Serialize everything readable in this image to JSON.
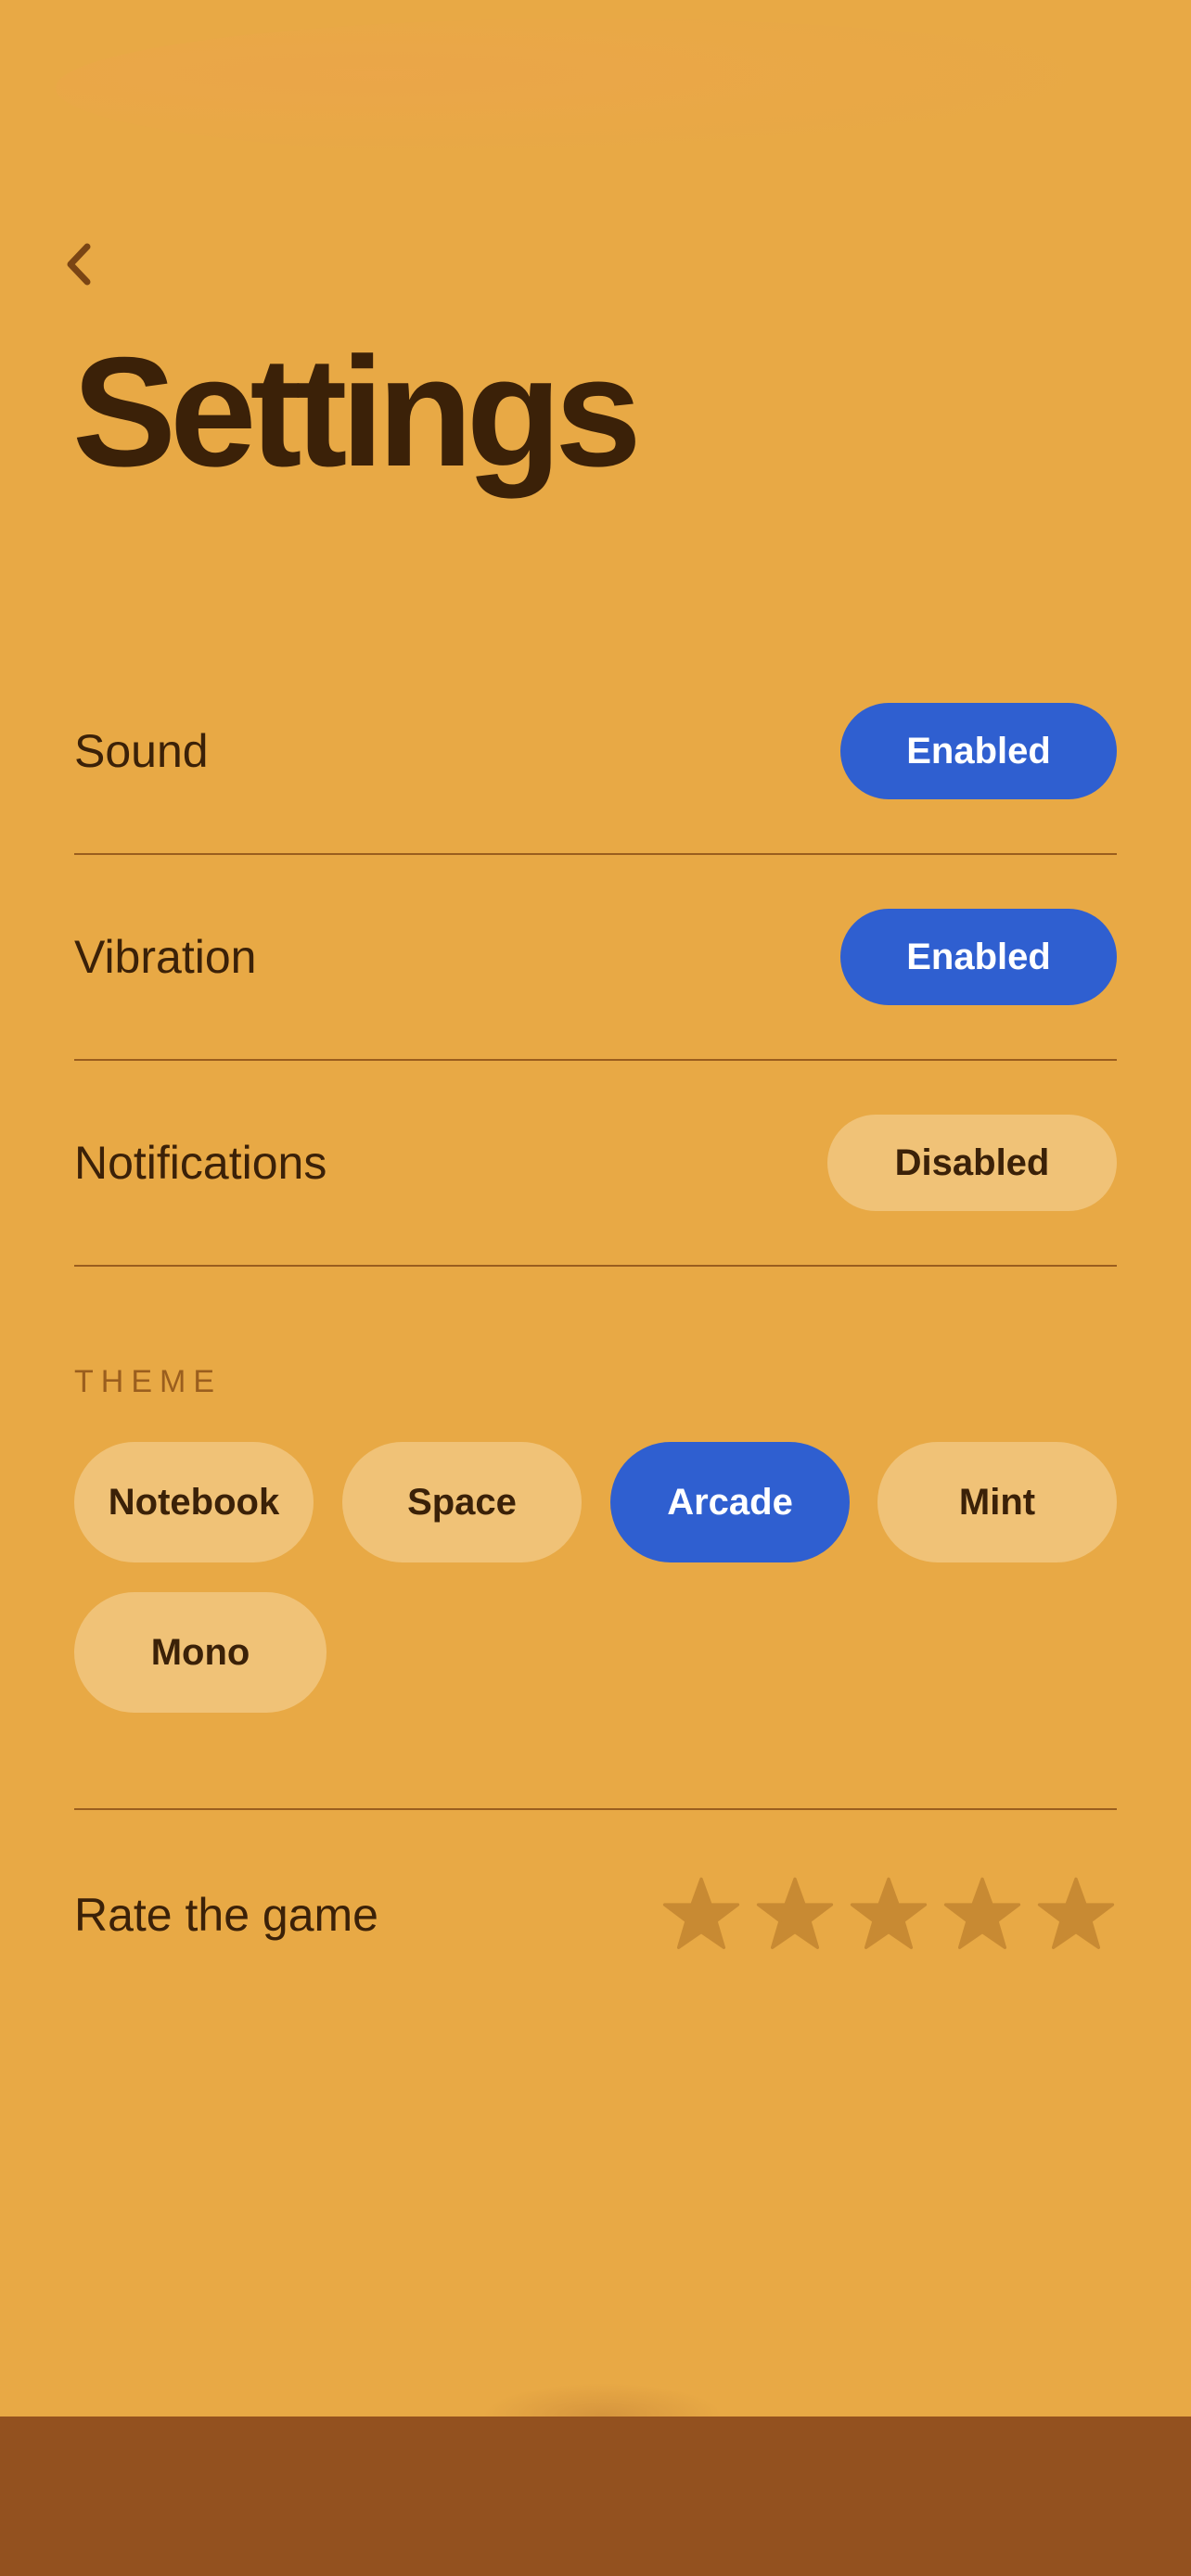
{
  "header": {
    "back_icon": "chevron-left-icon",
    "title": "Settings"
  },
  "settings": [
    {
      "label": "Sound",
      "state": "Enabled",
      "enabled": true
    },
    {
      "label": "Vibration",
      "state": "Enabled",
      "enabled": true
    },
    {
      "label": "Notifications",
      "state": "Disabled",
      "enabled": false
    }
  ],
  "theme": {
    "label": "THEME",
    "options": [
      "Notebook",
      "Space",
      "Arcade",
      "Mint",
      "Mono"
    ],
    "selected": "Arcade"
  },
  "rating": {
    "label": "Rate the game",
    "max": 5,
    "value": 0,
    "icon": "star-icon"
  },
  "colors": {
    "background": "#E8A945",
    "accent": "#2F5FD0",
    "pill_inactive": "#F0C277",
    "text": "#3B2108",
    "divider": "#9A5E1E",
    "footer": "#93511F",
    "star": "#C88A33"
  }
}
